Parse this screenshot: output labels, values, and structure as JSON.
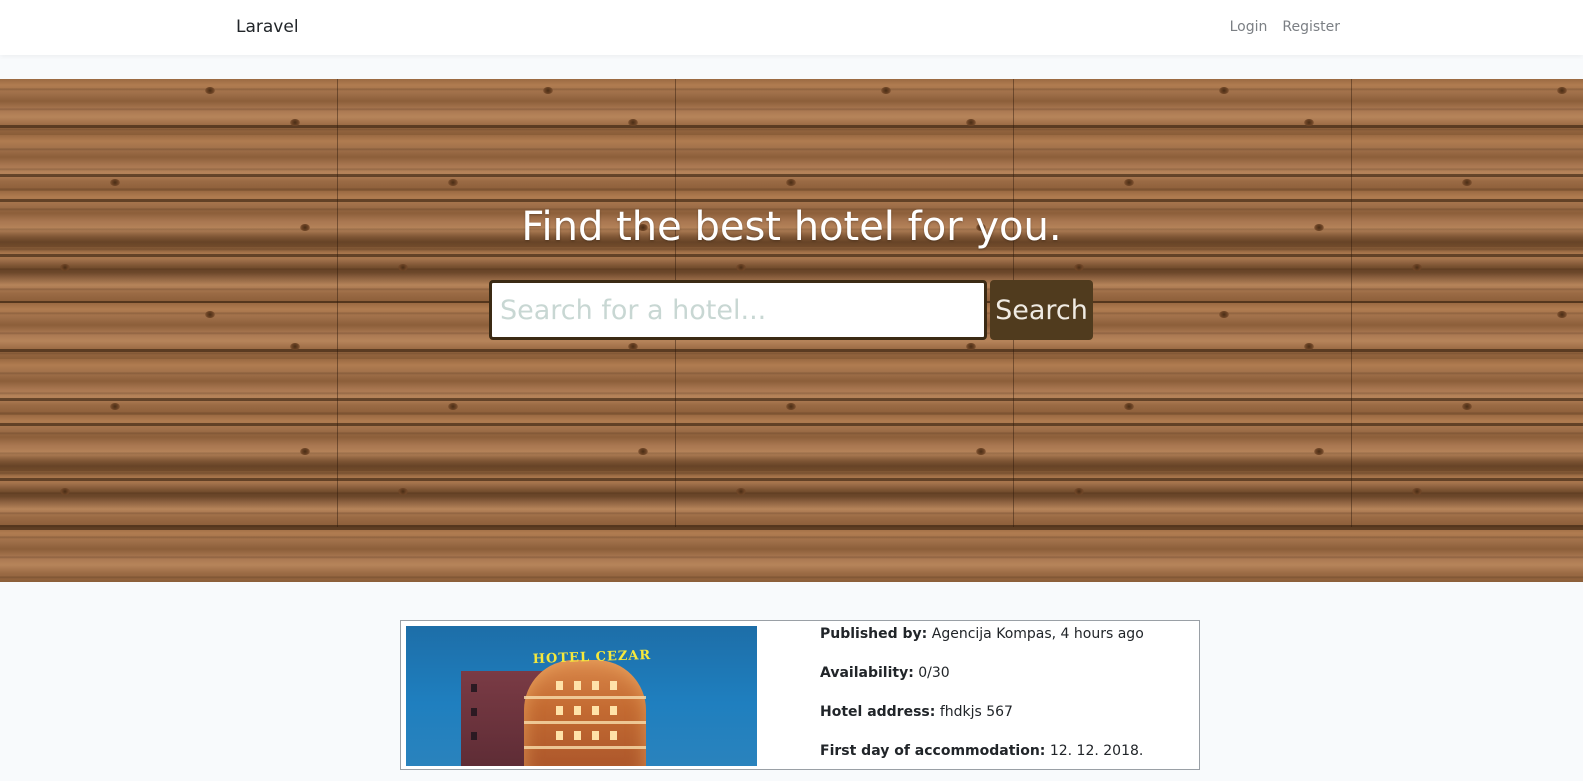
{
  "navbar": {
    "brand": "Laravel",
    "login": "Login",
    "register": "Register"
  },
  "hero": {
    "title": "Find the best hotel for you.",
    "search_placeholder": "Search for a hotel...",
    "search_value": "",
    "search_button": "Search"
  },
  "hotel": {
    "image_sign": "HOTEL CEZAR",
    "published_by_label": "Published by:",
    "published_by_value": "Agencija Kompas, 4 hours ago",
    "availability_label": "Availability:",
    "availability_value": "0/30",
    "address_label": "Hotel address:",
    "address_value": "fhdkjs 567",
    "first_day_label": "First day of accommodation:",
    "first_day_value": "12. 12. 2018."
  },
  "colors": {
    "search_button_bg": "#503b1e",
    "placeholder": "#c8d7d3",
    "page_bg": "#f8fafc"
  }
}
